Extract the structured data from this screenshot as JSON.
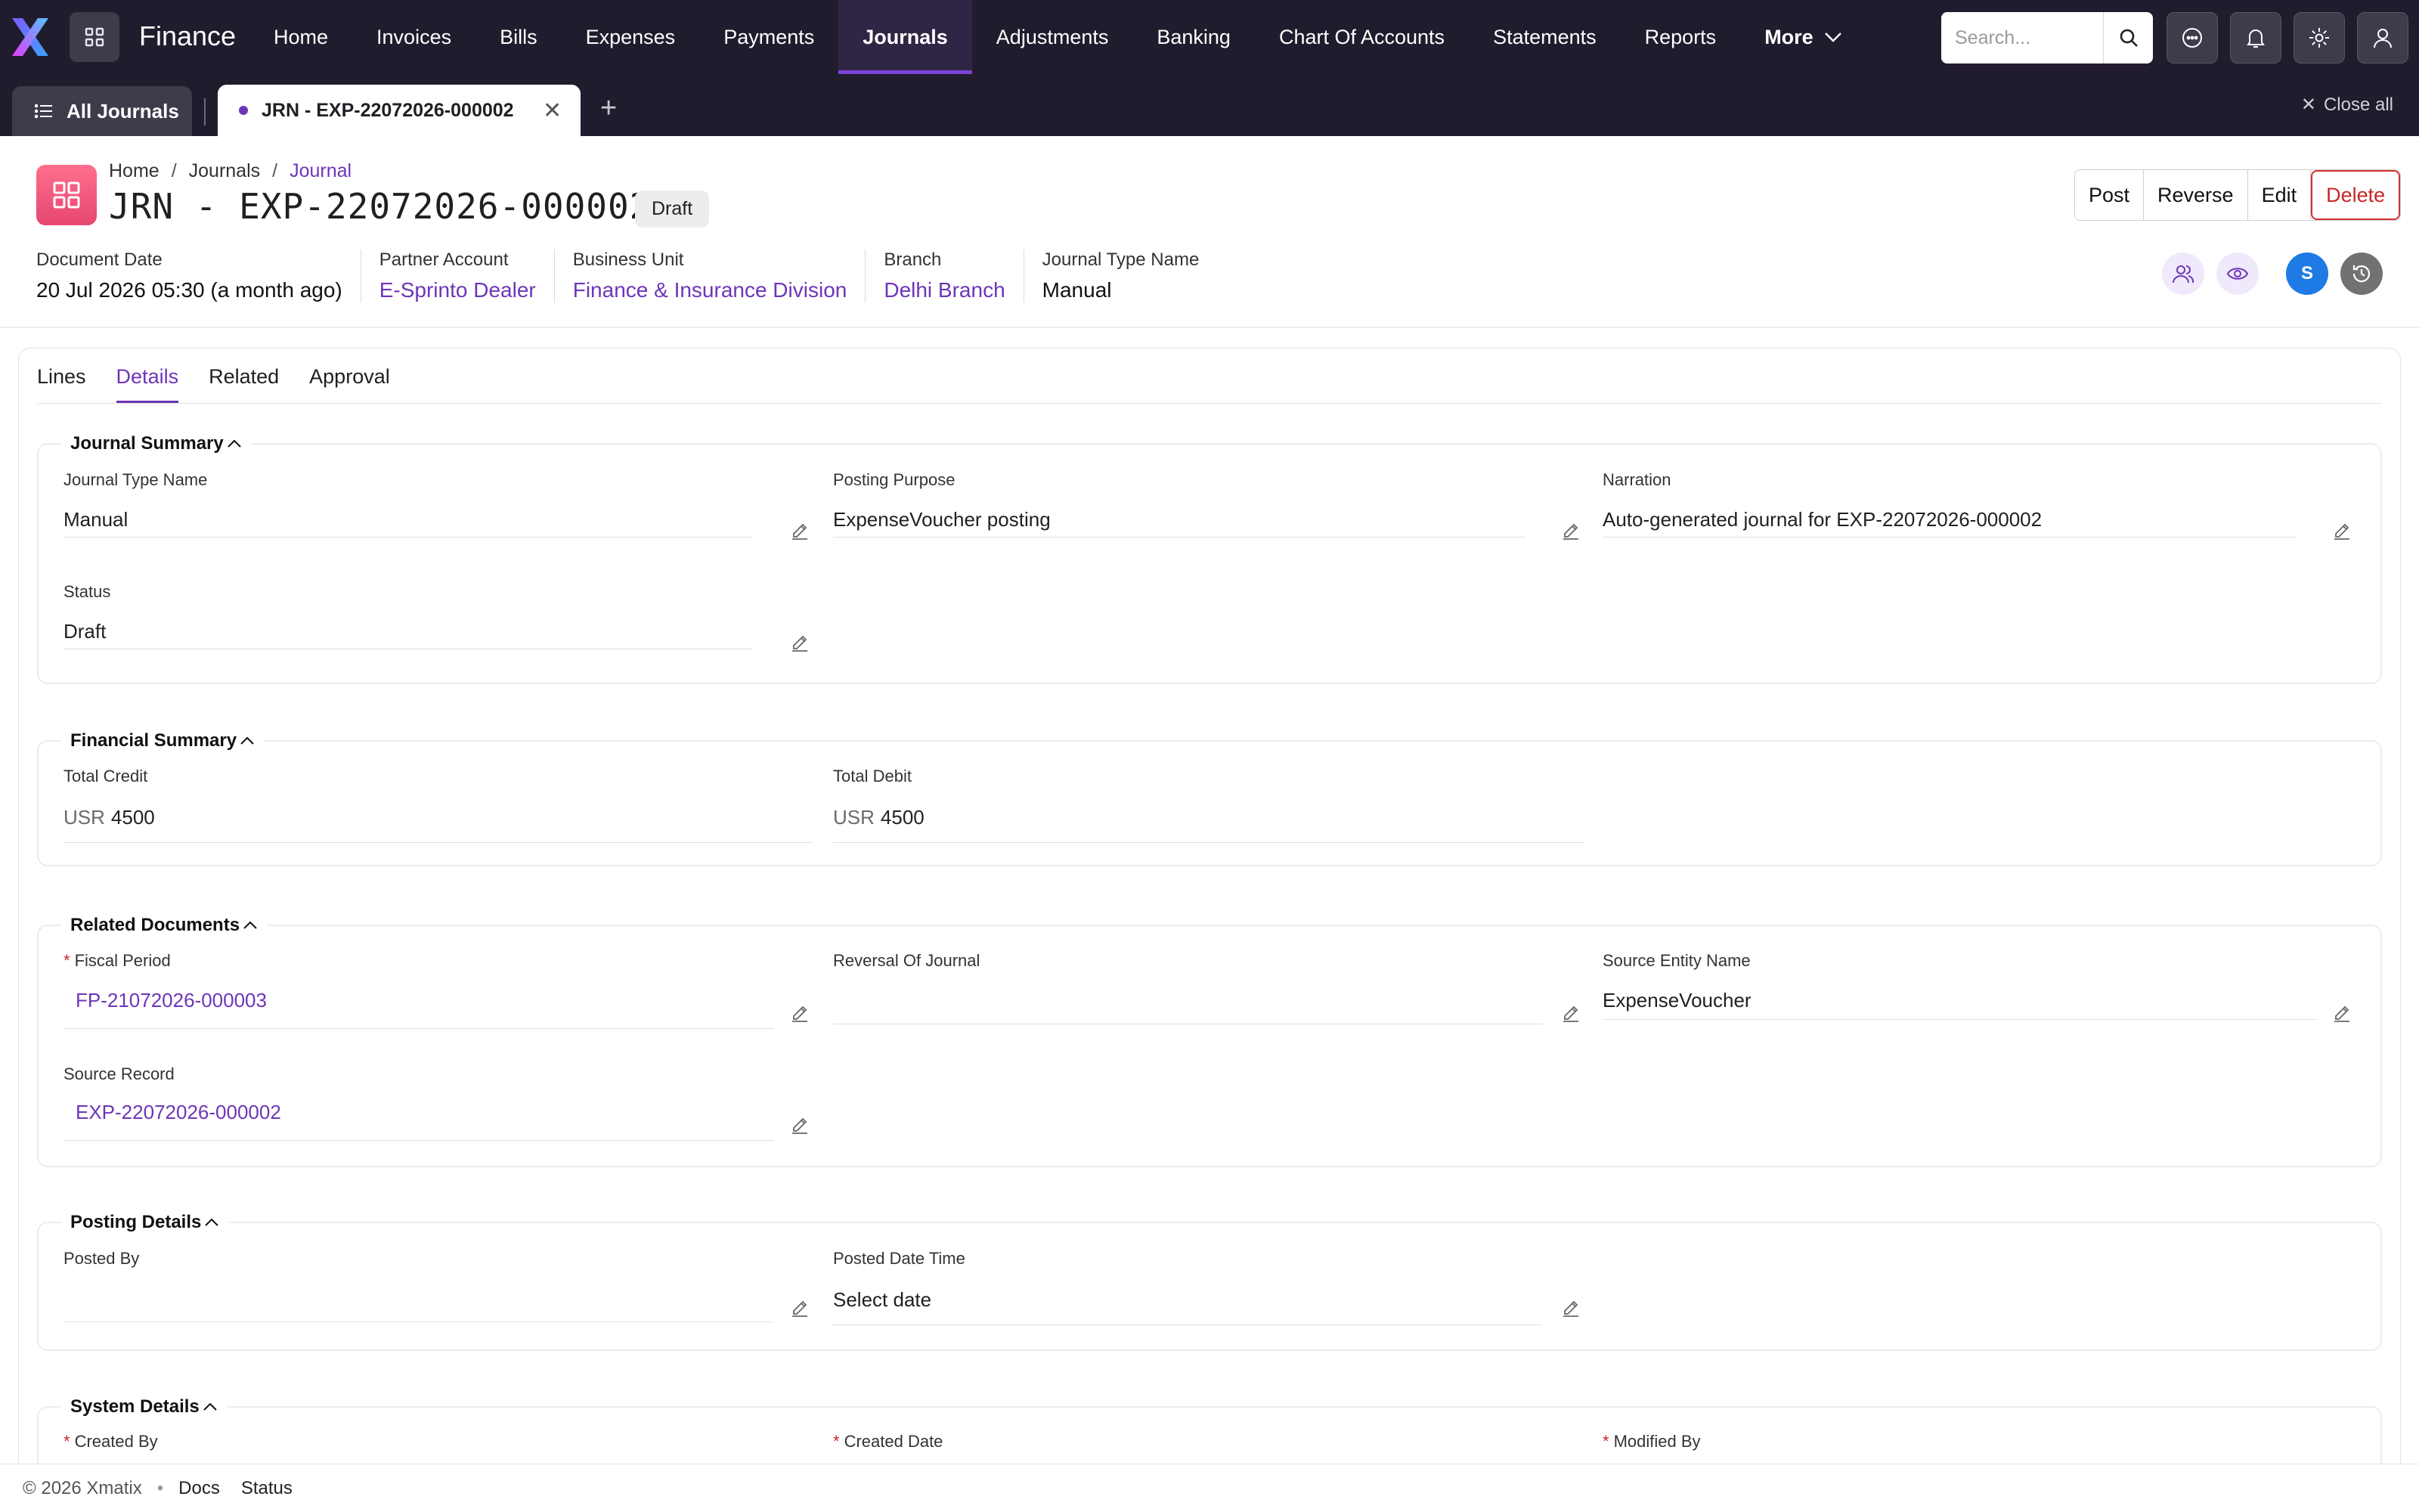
{
  "app": {
    "name": "Finance",
    "brand_color": "#6d35b8",
    "topbar_color": "#211c2d"
  },
  "nav": {
    "items": [
      {
        "label": "Home"
      },
      {
        "label": "Invoices"
      },
      {
        "label": "Bills"
      },
      {
        "label": "Expenses"
      },
      {
        "label": "Payments"
      },
      {
        "label": "Journals",
        "active": true
      },
      {
        "label": "Adjustments"
      },
      {
        "label": "Banking"
      },
      {
        "label": "Chart Of Accounts"
      },
      {
        "label": "Statements"
      },
      {
        "label": "Reports"
      }
    ],
    "more_label": "More",
    "search_placeholder": "Search..."
  },
  "tabstrip": {
    "all_label": "All Journals",
    "doc_tab_label": "JRN - EXP-22072026-000002",
    "close_all_label": "Close all"
  },
  "record": {
    "breadcrumb": [
      "Home",
      "Journals",
      "Journal"
    ],
    "title": "JRN - EXP-22072026-000002",
    "status": "Draft",
    "actions": {
      "post": "Post",
      "reverse": "Reverse",
      "edit": "Edit",
      "delete": "Delete"
    },
    "avatar_initial": "S",
    "meta": [
      {
        "label": "Document Date",
        "value": "20 Jul 2026 05:30 (a month ago)",
        "link": false
      },
      {
        "label": "Partner Account",
        "value": "E-Sprinto Dealer",
        "link": true
      },
      {
        "label": "Business Unit",
        "value": "Finance & Insurance Division",
        "link": true
      },
      {
        "label": "Branch",
        "value": "Delhi Branch",
        "link": true
      },
      {
        "label": "Journal Type Name",
        "value": "Manual",
        "link": false
      }
    ]
  },
  "tabs": [
    {
      "label": "Lines"
    },
    {
      "label": "Details",
      "active": true
    },
    {
      "label": "Related"
    },
    {
      "label": "Approval"
    }
  ],
  "sections": {
    "journal_summary": {
      "title": "Journal Summary",
      "journal_type_name": {
        "label": "Journal Type Name",
        "value": "Manual"
      },
      "posting_purpose": {
        "label": "Posting Purpose",
        "value": "ExpenseVoucher posting"
      },
      "narration": {
        "label": "Narration",
        "value": "Auto-generated journal for EXP-22072026-000002"
      },
      "status": {
        "label": "Status",
        "value": "Draft"
      }
    },
    "financial_summary": {
      "title": "Financial Summary",
      "total_credit": {
        "label": "Total Credit",
        "currency": "USR",
        "value": "4500"
      },
      "total_debit": {
        "label": "Total Debit",
        "currency": "USR",
        "value": "4500"
      }
    },
    "related_documents": {
      "title": "Related Documents",
      "fiscal_period": {
        "label": "Fiscal Period",
        "value": "FP-21072026-000003",
        "required": true
      },
      "reversal_of_journal": {
        "label": "Reversal Of Journal",
        "value": ""
      },
      "source_entity_name": {
        "label": "Source Entity Name",
        "value": "ExpenseVoucher"
      },
      "source_record": {
        "label": "Source Record",
        "value": "EXP-22072026-000002"
      }
    },
    "posting_details": {
      "title": "Posting Details",
      "posted_by": {
        "label": "Posted By",
        "value": ""
      },
      "posted_date_time": {
        "label": "Posted Date Time",
        "value": "Select date"
      }
    },
    "system_details": {
      "title": "System Details",
      "created_by": {
        "label": "Created By",
        "required": true
      },
      "created_date": {
        "label": "Created Date",
        "required": true
      },
      "modified_by": {
        "label": "Modified By",
        "required": true
      }
    }
  },
  "footer": {
    "copyright": "© 2026 Xmatix",
    "links": [
      "Docs",
      "Status"
    ]
  }
}
